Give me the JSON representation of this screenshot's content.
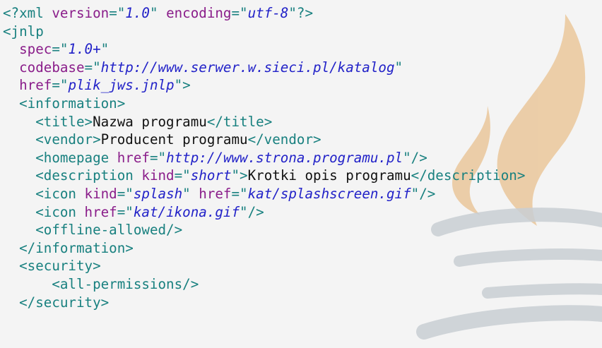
{
  "colors": {
    "background": "#f4f4f4",
    "tag": "#18807f",
    "attribute": "#8a1d8a",
    "value": "#2222c8",
    "text": "#111111",
    "watermark_flame": "#e9c18f",
    "watermark_cup": "#c9cfd4"
  },
  "watermark": {
    "icon": "java-coffee-cup-icon"
  },
  "code": {
    "l1": {
      "open": "<?xml ",
      "a1": "version",
      "eq1": "=\"",
      "v1": "1.0",
      "q1": "\" ",
      "a2": "encoding",
      "eq2": "=\"",
      "v2": "utf-8",
      "close": "\"?>"
    },
    "l2": {
      "tag": "<jnlp"
    },
    "l3": {
      "indent": "  ",
      "attr": "spec",
      "eq": "=\"",
      "val": "1.0+",
      "q": "\""
    },
    "l4": {
      "indent": "  ",
      "attr": "codebase",
      "eq": "=\"",
      "val": "http://www.serwer.w.sieci.pl/katalog",
      "q": "\""
    },
    "l5": {
      "indent": "  ",
      "attr": "href",
      "eq": "=\"",
      "val": "plik_jws.jnlp",
      "close": "\">"
    },
    "l6": {
      "indent": "  ",
      "tag": "<information>"
    },
    "l7": {
      "indent": "    ",
      "open": "<title>",
      "text": "Nazwa programu",
      "close": "</title>"
    },
    "l8": {
      "indent": "    ",
      "open": "<vendor>",
      "text": "Producent programu",
      "close": "</vendor>"
    },
    "l9": {
      "indent": "    ",
      "open": "<homepage ",
      "attr": "href",
      "eq": "=\"",
      "val": "http://www.strona.programu.pl",
      "close": "\"/>"
    },
    "l10": {
      "indent": "    ",
      "open": "<description ",
      "attr": "kind",
      "eq": "=\"",
      "val": "short",
      "gt": "\">",
      "text": "Krotki opis programu",
      "close": "</description>"
    },
    "l11": {
      "indent": "    ",
      "open": "<icon ",
      "a1": "kind",
      "eq1": "=\"",
      "v1": "splash",
      "q1": "\" ",
      "a2": "href",
      "eq2": "=\"",
      "v2": "kat/splashscreen.gif",
      "close": "\"/>"
    },
    "l12": {
      "indent": "    ",
      "open": "<icon ",
      "attr": "href",
      "eq": "=\"",
      "val": "kat/ikona.gif",
      "close": "\"/>"
    },
    "l13": {
      "indent": "    ",
      "tag": "<offline-allowed/>"
    },
    "l14": {
      "indent": "  ",
      "tag": "</information>"
    },
    "l15": {
      "indent": "  ",
      "tag": "<security>"
    },
    "l16": {
      "indent": "      ",
      "tag": "<all-permissions/>"
    },
    "l17": {
      "indent": "  ",
      "tag": "</security>"
    }
  }
}
